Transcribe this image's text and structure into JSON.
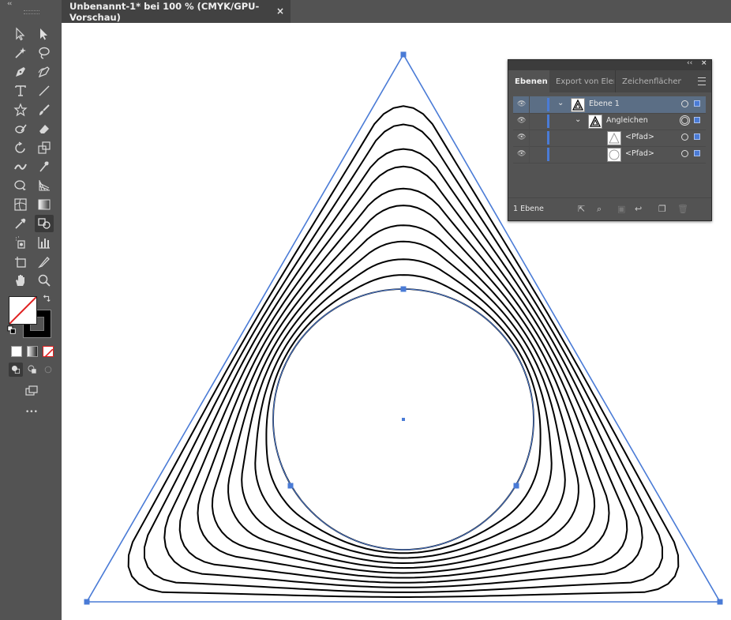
{
  "document_tab": {
    "title": "Unbenannt-1* bei 100 % (CMYK/GPU-Vorschau)",
    "close_glyph": "×"
  },
  "toolbar": {
    "collapse_glyph": "‹‹",
    "more_glyph": "•••",
    "tools": [
      "selection-tool",
      "direct-selection-tool",
      "magic-wand-tool",
      "lasso-tool",
      "pen-tool",
      "curvature-tool",
      "type-tool",
      "line-tool",
      "star-tool",
      "paintbrush-tool",
      "shaper-tool",
      "eraser-tool",
      "rotate-tool",
      "scale-tool",
      "width-tool",
      "puppet-warp-tool",
      "shape-builder-tool",
      "perspective-grid-tool",
      "mesh-tool",
      "gradient-tool",
      "eyedropper-tool",
      "blend-tool",
      "symbol-sprayer-tool",
      "column-graph-tool",
      "artboard-tool",
      "slice-tool",
      "hand-tool",
      "zoom-tool"
    ],
    "fill": "none",
    "stroke": "#000000"
  },
  "layers_panel": {
    "collapse_glyph": "‹‹",
    "close_glyph": "×",
    "tabs": [
      "Ebenen",
      "Export von Elem",
      "Zeichenflächen"
    ],
    "active_tab": "Ebenen",
    "rows": [
      {
        "name": "Ebene 1",
        "level": 0,
        "expanded": true,
        "selected": true
      },
      {
        "name": "Angleichen",
        "level": 1,
        "expanded": true,
        "selected": false
      },
      {
        "name": "<Pfad>",
        "level": 2,
        "selected": false
      },
      {
        "name": "<Pfad>",
        "level": 2,
        "selected": false
      }
    ],
    "footer_count": "1 Ebene"
  },
  "artwork": {
    "object": "blend of triangle and circle",
    "steps": 10,
    "selection_color": "#4a7bd6"
  }
}
